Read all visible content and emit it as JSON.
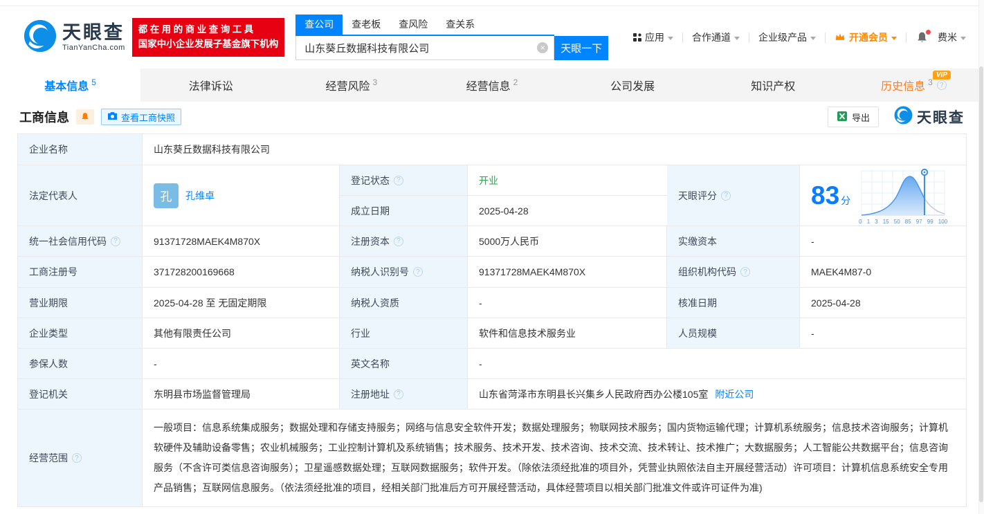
{
  "icons": {
    "help": "?",
    "clear": "×"
  },
  "header": {
    "logo_title": "天眼查",
    "logo_domain": "TianYanCha.com",
    "slogan_line1": "都在用的商业查询工具",
    "slogan_line2": "国家中小企业发展子基金旗下机构",
    "search_tabs": [
      {
        "label": "查公司"
      },
      {
        "label": "查老板"
      },
      {
        "label": "查风险"
      },
      {
        "label": "查关系"
      }
    ],
    "search_value": "山东葵丘数据科技有限公司",
    "search_button": "天眼一下",
    "nav_apps": "应用",
    "nav_partner": "合作通道",
    "nav_enterprise": "企业级产品",
    "nav_vip": "开通会员",
    "nav_user": "费米"
  },
  "tabs": {
    "basic": {
      "label": "基本信息",
      "count": "5"
    },
    "legal": {
      "label": "法律诉讼",
      "count": ""
    },
    "risk": {
      "label": "经营风险",
      "count": "3"
    },
    "operation": {
      "label": "经营信息",
      "count": "2"
    },
    "development": {
      "label": "公司发展",
      "count": ""
    },
    "ip": {
      "label": "知识产权",
      "count": ""
    },
    "history": {
      "label": "历史信息",
      "count": "3",
      "vip_badge": "VIP"
    }
  },
  "toolbar": {
    "title": "工商信息",
    "snapshot_button": "查看工商快照",
    "export_button": "导出",
    "brand": "天眼查"
  },
  "info": {
    "company_name": {
      "label": "企业名称",
      "value": "山东葵丘数据科技有限公司"
    },
    "legal_rep": {
      "label": "法定代表人",
      "avatar": "孔",
      "name": "孔维卓"
    },
    "reg_status": {
      "label": "登记状态",
      "value": "开业"
    },
    "establish_date": {
      "label": "成立日期",
      "value": "2025-04-28"
    },
    "score": {
      "label": "天眼评分",
      "value": "83",
      "unit": "分"
    },
    "credit_code": {
      "label": "统一社会信用代码",
      "value": "91371728MAEK4M870X"
    },
    "reg_capital": {
      "label": "注册资本",
      "value": "5000万人民币"
    },
    "paid_capital": {
      "label": "实缴资本",
      "value": "-"
    },
    "reg_number": {
      "label": "工商注册号",
      "value": "371728200169668"
    },
    "taxpayer_id": {
      "label": "纳税人识别号",
      "value": "91371728MAEK4M870X"
    },
    "org_code": {
      "label": "组织机构代码",
      "value": "MAEK4M87-0"
    },
    "business_term": {
      "label": "营业期限",
      "value": "2025-04-28 至 无固定期限"
    },
    "taxpayer_quality": {
      "label": "纳税人资质",
      "value": "-"
    },
    "approval_date": {
      "label": "核准日期",
      "value": "2025-04-28"
    },
    "company_type": {
      "label": "企业类型",
      "value": "其他有限责任公司"
    },
    "industry": {
      "label": "行业",
      "value": "软件和信息技术服务业"
    },
    "staff_size": {
      "label": "人员规模",
      "value": "-"
    },
    "insured_count": {
      "label": "参保人数",
      "value": "-"
    },
    "english_name": {
      "label": "英文名称",
      "value": "-"
    },
    "reg_authority": {
      "label": "登记机关",
      "value": "东明县市场监督管理局"
    },
    "reg_address": {
      "label": "注册地址",
      "value": "山东省菏泽市东明县长兴集乡人民政府西办公楼105室",
      "link": "附近公司"
    },
    "business_scope": {
      "label": "经营范围",
      "value": "一般项目：信息系统集成服务；数据处理和存储支持服务；网络与信息安全软件开发；数据处理服务；物联网技术服务；国内货物运输代理；计算机系统服务；信息技术咨询服务；计算机软硬件及辅助设备零售；农业机械服务；工业控制计算机及系统销售；技术服务、技术开发、技术咨询、技术交流、技术转让、技术推广；大数据服务；人工智能公共数据平台；信息咨询服务（不含许可类信息咨询服务）；卫星遥感数据处理；互联网数据服务；软件开发。（除依法须经批准的项目外，凭营业执照依法自主开展经营活动）许可项目：计算机信息系统安全专用产品销售；互联网信息服务。（依法须经批准的项目，经相关部门批准后方可开展经营活动，具体经营项目以相关部门批准文件或许可证件为准)"
    }
  },
  "chart_data": {
    "type": "area",
    "title": "天眼评分",
    "score": 83,
    "x_ticks": [
      "0",
      "1",
      "3",
      "15",
      "50",
      "85",
      "97",
      "99",
      "100"
    ],
    "marker_at": "85",
    "accent_color": "#0b7bff",
    "curve_color": "#4a97ea",
    "tail_color": "#c4c9d2"
  }
}
